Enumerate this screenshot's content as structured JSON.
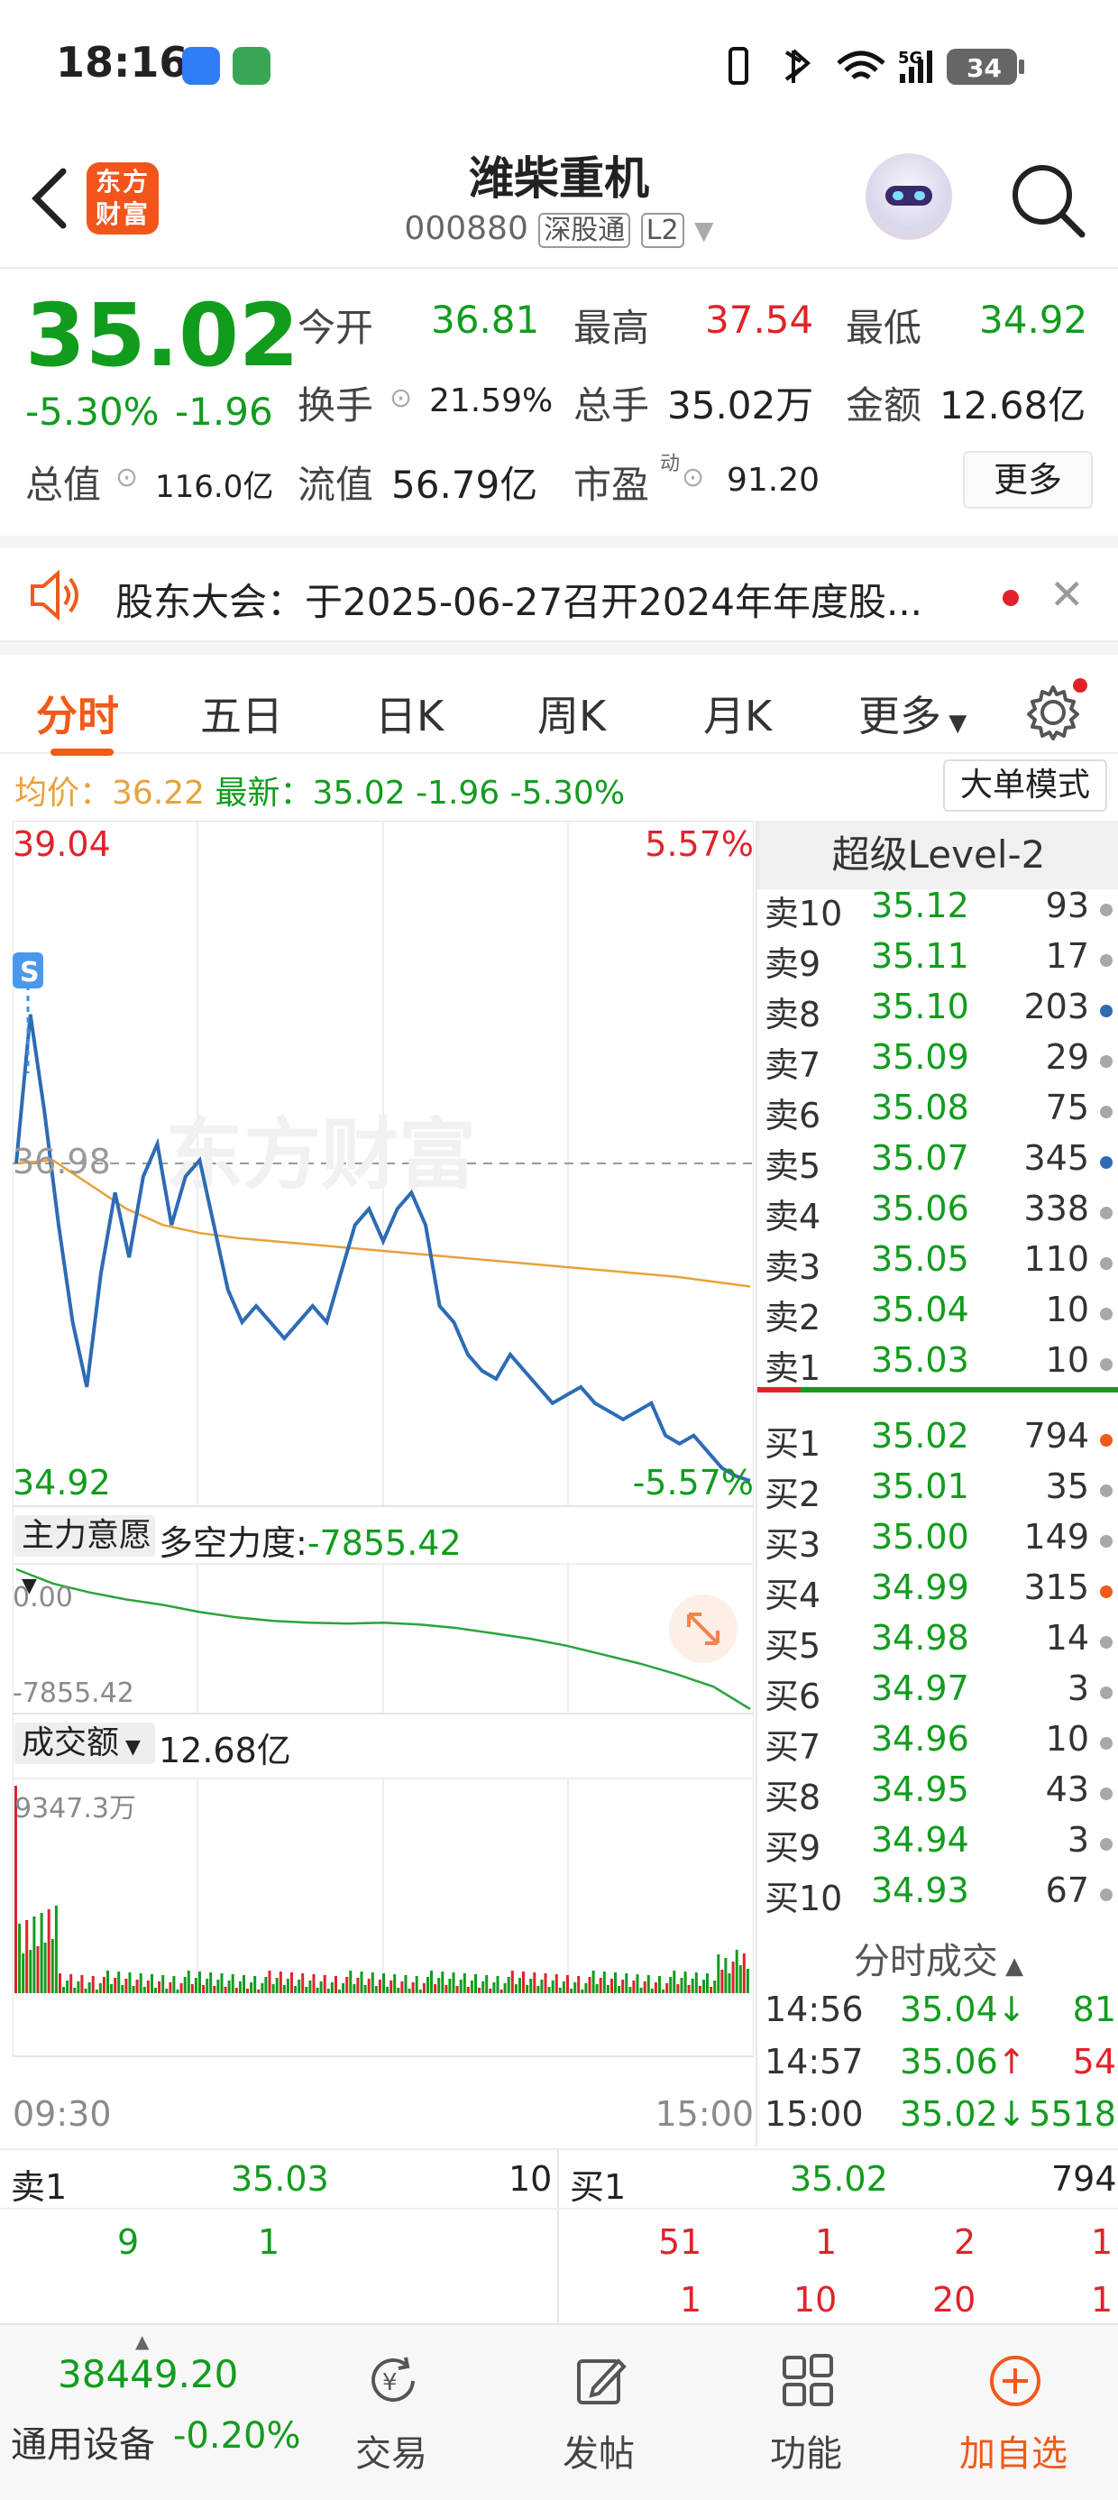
{
  "status_bar": {
    "time": "18:16",
    "battery": "34"
  },
  "header": {
    "logo_text": "东方财富",
    "title": "潍柴重机",
    "code": "000880",
    "tag1": "深股通",
    "tag2": "L2"
  },
  "quote": {
    "price": "35.02",
    "change_pct": "-5.30%",
    "change": "-1.96",
    "open_label": "今开",
    "open": "36.81",
    "high_label": "最高",
    "high": "37.54",
    "low_label": "最低",
    "low": "34.92",
    "turnover_label": "换手",
    "turnover": "21.59%",
    "volume_label": "总手",
    "volume": "35.02万",
    "amount_label": "金额",
    "amount": "12.68亿",
    "mktcap_label": "总值",
    "mktcap": "116.0亿",
    "float_label": "流值",
    "float_value": "56.79亿",
    "pe_label": "市盈",
    "pe_sup": "动",
    "pe": "91.20",
    "more_label": "更多"
  },
  "notice": {
    "text": "股东大会：于2025-06-27召开2024年年度股..."
  },
  "tabs": [
    "分时",
    "五日",
    "日K",
    "周K",
    "月K",
    "更多"
  ],
  "avgbar": {
    "avg_label": "均价：",
    "avg": "36.22",
    "latest_label": "最新：",
    "latest": "35.02",
    "chg": "-1.96",
    "chg_pct": "-5.30%",
    "big_order_btn": "大单模式"
  },
  "chart": {
    "top_price": "39.04",
    "top_pct": "5.57%",
    "bottom_price": "34.92",
    "bottom_pct": "-5.57%",
    "ref_price": "36.98",
    "watermark": "东方财富",
    "s_marker": "S",
    "indicator_select": "主力意愿",
    "indicator_label": "多空力度:",
    "indicator_value": "-7855.42",
    "ind_top": "0.00",
    "ind_bottom": "-7855.42",
    "vol_select": "成交额",
    "vol_value": "12.68亿",
    "vol_max": "9347.3万",
    "time_start": "09:30",
    "time_end": "15:00"
  },
  "colors": {
    "up": "#e0232a",
    "down": "#119c1d",
    "avg": "#e8a23a",
    "line": "#2d6bb5",
    "accent": "#f05a1a"
  },
  "book": {
    "title": "超级Level-2",
    "asks": [
      {
        "label": "卖10",
        "price": "35.12",
        "qty": "93",
        "dot": "gray"
      },
      {
        "label": "卖9",
        "price": "35.11",
        "qty": "17",
        "dot": "gray"
      },
      {
        "label": "卖8",
        "price": "35.10",
        "qty": "203",
        "dot": "blue"
      },
      {
        "label": "卖7",
        "price": "35.09",
        "qty": "29",
        "dot": "gray"
      },
      {
        "label": "卖6",
        "price": "35.08",
        "qty": "75",
        "dot": "gray"
      },
      {
        "label": "卖5",
        "price": "35.07",
        "qty": "345",
        "dot": "blue"
      },
      {
        "label": "卖4",
        "price": "35.06",
        "qty": "338",
        "dot": "gray"
      },
      {
        "label": "卖3",
        "price": "35.05",
        "qty": "110",
        "dot": "gray"
      },
      {
        "label": "卖2",
        "price": "35.04",
        "qty": "10",
        "dot": "gray"
      },
      {
        "label": "卖1",
        "price": "35.03",
        "qty": "10",
        "dot": "gray"
      }
    ],
    "bids": [
      {
        "label": "买1",
        "price": "35.02",
        "qty": "794",
        "dot": "orange"
      },
      {
        "label": "买2",
        "price": "35.01",
        "qty": "35",
        "dot": "gray"
      },
      {
        "label": "买3",
        "price": "35.00",
        "qty": "149",
        "dot": "gray"
      },
      {
        "label": "买4",
        "price": "34.99",
        "qty": "315",
        "dot": "orange"
      },
      {
        "label": "买5",
        "price": "34.98",
        "qty": "14",
        "dot": "gray"
      },
      {
        "label": "买6",
        "price": "34.97",
        "qty": "3",
        "dot": "gray"
      },
      {
        "label": "买7",
        "price": "34.96",
        "qty": "10",
        "dot": "gray"
      },
      {
        "label": "买8",
        "price": "34.95",
        "qty": "43",
        "dot": "gray"
      },
      {
        "label": "买9",
        "price": "34.94",
        "qty": "3",
        "dot": "gray"
      },
      {
        "label": "买10",
        "price": "34.93",
        "qty": "67",
        "dot": "gray"
      }
    ],
    "trades_title": "分时成交",
    "trades": [
      {
        "time": "14:56",
        "price": "35.04",
        "dir": "↓",
        "qty": "81",
        "qcolor": "green"
      },
      {
        "time": "14:57",
        "price": "35.06",
        "dir": "↑",
        "qty": "54",
        "qcolor": "red"
      },
      {
        "time": "15:00",
        "price": "35.02",
        "dir": "↓",
        "qty": "5518",
        "qcolor": "green"
      }
    ]
  },
  "summary": {
    "ask_label": "卖1",
    "ask_price": "35.03",
    "ask_qty": "10",
    "bid_label": "买1",
    "bid_price": "35.02",
    "bid_qty": "794",
    "ask_queue_row1": [
      "9",
      "1"
    ],
    "bid_queue_row1": [
      "51",
      "1",
      "2",
      "1"
    ],
    "bid_queue_row2": [
      "1",
      "10",
      "20",
      "1"
    ]
  },
  "nav": {
    "index_value": "38449.20",
    "index_name": "通用设备",
    "index_chg": "-0.20%",
    "items": [
      "交易",
      "发帖",
      "功能",
      "加自选"
    ]
  }
}
